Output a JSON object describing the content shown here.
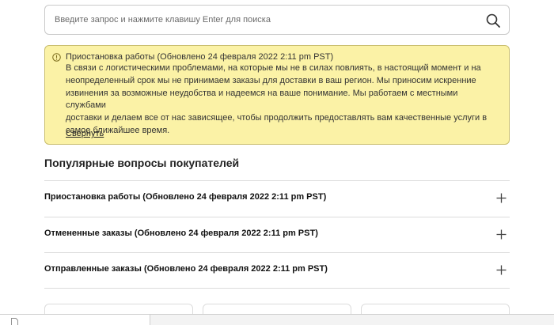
{
  "search": {
    "placeholder": "Введите запрос и нажмите клавишу Enter для поиска",
    "icon": "search-icon"
  },
  "notice": {
    "icon": "info-icon",
    "title": "Приостановка работы (Обновлено 24 февраля 2022 2:11 pm PST)",
    "lines": [
      "В связи с логистическими проблемами, на которые мы не в силах повлиять, в настоящий момент и на",
      "неопределенный срок мы не принимаем заказы для доставки в ваш регион. Мы приносим искренние",
      "извинения за возможные неудобства и надеемся на ваше понимание. Мы работаем с местными службами",
      "доставки и делаем все от нас зависящее, чтобы продолжить предоставлять вам качественные услуги в",
      "самое ближайшее время."
    ],
    "collapse_label": "Свернуть",
    "background": "#fbf2a6",
    "border": "#c9be6f"
  },
  "faq": {
    "title": "Популярные вопросы покупателей",
    "items": [
      {
        "label": "Приостановка работы (Обновлено 24 февраля 2022 2:11 pm PST)"
      },
      {
        "label": "Отмененные заказы (Обновлено 24 февраля 2022 2:11 pm PST)"
      },
      {
        "label": "Отправленные заказы (Обновлено 24 февраля 2022 2:11 pm PST)"
      }
    ],
    "expand_icon": "plus-icon"
  },
  "colors": {
    "divider": "#dcdcdc",
    "text": "#222222"
  }
}
